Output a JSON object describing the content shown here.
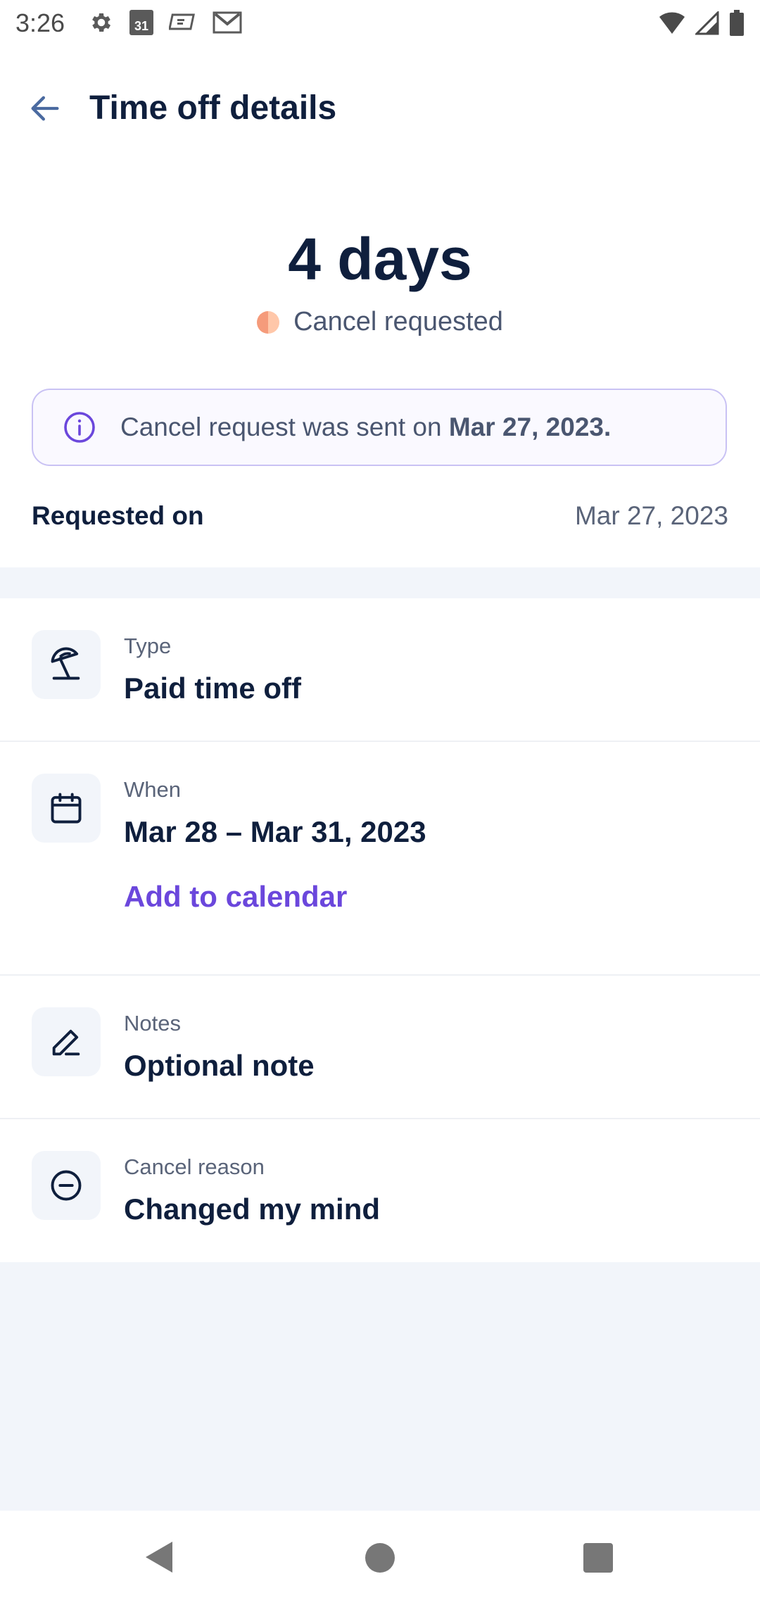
{
  "status_bar": {
    "time": "3:26",
    "left_icons": [
      "gear-icon",
      "calendar-31-icon",
      "photo-icon",
      "gmail-icon"
    ],
    "right_icons": [
      "wifi-icon",
      "cell-signal-icon",
      "battery-icon"
    ],
    "calendar_day": "31"
  },
  "header": {
    "title": "Time off details"
  },
  "summary": {
    "amount": "4 days",
    "status": "Cancel requested",
    "status_colors": [
      "#f59b7b",
      "#ffc7a9"
    ]
  },
  "info_banner": {
    "text_prefix": "Cancel request was sent on ",
    "date": "Mar 27, 2023."
  },
  "requested": {
    "label": "Requested on",
    "value": "Mar 27, 2023"
  },
  "details": {
    "type": {
      "label": "Type",
      "value": "Paid time off",
      "icon": "beach-umbrella-icon"
    },
    "when": {
      "label": "When",
      "value": "Mar 28 – Mar 31, 2023",
      "link": "Add to calendar",
      "icon": "calendar-icon"
    },
    "notes": {
      "label": "Notes",
      "value": "Optional note",
      "icon": "pencil-icon"
    },
    "cancel_reason": {
      "label": "Cancel reason",
      "value": "Changed my mind",
      "icon": "minus-circle-icon"
    }
  },
  "colors": {
    "primary_text": "#0f1f3d",
    "accent": "#6b47dc",
    "banner_border": "#c9c2f4",
    "muted_background": "#f2f5fa"
  }
}
